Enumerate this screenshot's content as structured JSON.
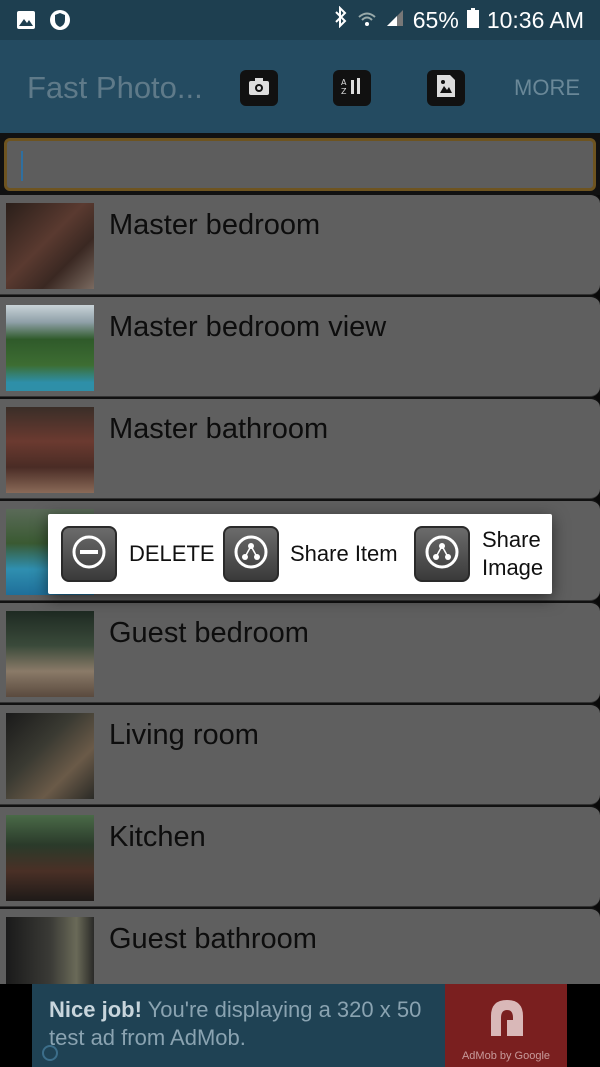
{
  "status_bar": {
    "battery_pct": "65%",
    "time": "10:36 AM"
  },
  "action_bar": {
    "title": "Fast Photo...",
    "more": "MORE"
  },
  "search": {
    "value": ""
  },
  "list": {
    "items": [
      {
        "label": "Master bedroom"
      },
      {
        "label": "Master bedroom view"
      },
      {
        "label": "Master bathroom"
      },
      {
        "label": ""
      },
      {
        "label": "Guest bedroom"
      },
      {
        "label": "Living room"
      },
      {
        "label": "Kitchen"
      },
      {
        "label": "Guest bathroom"
      }
    ]
  },
  "popup": {
    "delete": "DELETE",
    "share_item": "Share Item",
    "share_image": "Share Image"
  },
  "ad": {
    "bold": "Nice job!",
    "text": " You're displaying a 320 x 50 test ad from AdMob.",
    "logo": "AdMob by Google"
  },
  "colors": {
    "action_bar": "#244b61",
    "status_bar": "#1e3f50",
    "list_item": "#5f5f5f",
    "search_border": "#6e5420"
  }
}
